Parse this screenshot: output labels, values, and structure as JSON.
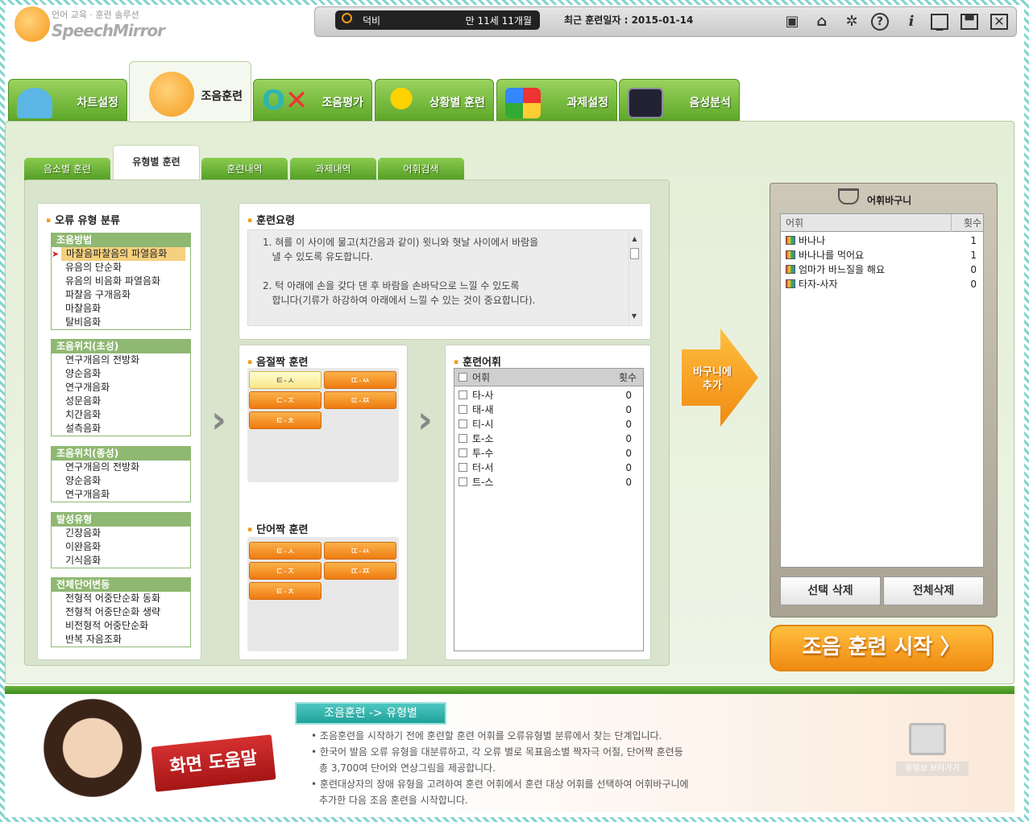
{
  "app": {
    "logo_sub": "언어 교육 · 훈련 솔루션",
    "logo_main": "SpeechMirror"
  },
  "user": {
    "name": "덕비",
    "age": "만 11세 11개월",
    "last_training": "최근 훈련일자 : 2015-01-14"
  },
  "toolbar_icons": [
    "person-desk-icon",
    "home-icon",
    "gear-icon",
    "help-icon",
    "info-icon",
    "minimize-icon",
    "restore-icon",
    "close-icon"
  ],
  "main_tabs": [
    "차트설정",
    "조음훈련",
    "조음평가",
    "상황별 훈련",
    "과제설정",
    "음성분석"
  ],
  "active_main_tab": "조음훈련",
  "sub_tabs": [
    "음소별 훈련",
    "유형별 훈련",
    "훈련내역",
    "과제내역",
    "어휘검색"
  ],
  "active_sub_tab": "유형별 훈련",
  "error_panel": {
    "title": "오류 유형 분류",
    "groups": [
      {
        "name": "조음방법",
        "items": [
          "마찰음파찰음의 파열음화",
          "유음의 단순화",
          "유음의 비음화 파열음화",
          "파찰음 구개음화",
          "마찰음화",
          "탈비음화"
        ],
        "selected": 0
      },
      {
        "name": "조음위치(초성)",
        "items": [
          "연구개음의 전방화",
          "양순음화",
          "연구개음화",
          "성문음화",
          "치간음화",
          "설측음화"
        ]
      },
      {
        "name": "조음위치(종성)",
        "items": [
          "연구개음의 전방화",
          "양순음화",
          "연구개음화"
        ]
      },
      {
        "name": "발성유형",
        "items": [
          "긴장음화",
          "이완음화",
          "기식음화"
        ]
      },
      {
        "name": "전체단어변동",
        "items": [
          "전형적 어중단순화 동화",
          "전형적 어중단순화 생략",
          "비전형적 어중단순화",
          "반복 자음조화"
        ]
      }
    ]
  },
  "training_guide": {
    "title": "훈련요령",
    "lines": [
      "1. 혀를 이 사이에 물고(치간음과 같이) 윗니와 혓날 사이에서 바람을",
      "   낼 수 있도록 유도합니다.",
      "",
      "2. 턱 아래에 손을 갖다 댄 후 바람을 손바닥으로 느낄 수 있도록",
      "   합니다(기류가 하강하여 아래에서 느낄 수 있는 것이 중요합니다)."
    ]
  },
  "syllable_pair": {
    "title": "음절짝 훈련",
    "buttons": [
      "ㅌ-ㅅ",
      "ㄸ-ㅆ",
      "ㄷ-ㅈ",
      "ㄸ-ㅉ",
      "ㅌ-ㅊ"
    ],
    "selected": 0
  },
  "word_pair": {
    "title": "단어짝 훈련",
    "buttons": [
      "ㅌ-ㅅ",
      "ㄸ-ㅆ",
      "ㄷ-ㅈ",
      "ㄸ-ㅉ",
      "ㅌ-ㅊ"
    ]
  },
  "training_words": {
    "title": "훈련어휘",
    "col_word": "어휘",
    "col_count": "횟수",
    "rows": [
      {
        "word": "타-사",
        "count": "0"
      },
      {
        "word": "태-새",
        "count": "0"
      },
      {
        "word": "티-시",
        "count": "0"
      },
      {
        "word": "토-소",
        "count": "0"
      },
      {
        "word": "투-수",
        "count": "0"
      },
      {
        "word": "터-서",
        "count": "0"
      },
      {
        "word": "트-스",
        "count": "0"
      }
    ]
  },
  "add_button": {
    "line1": "바구니에",
    "line2": "추가"
  },
  "basket": {
    "title": "어휘바구니",
    "col_word": "어휘",
    "col_count": "횟수",
    "rows": [
      {
        "word": "바나나",
        "count": "1"
      },
      {
        "word": "바나나를 먹어요",
        "count": "1"
      },
      {
        "word": "엄마가 바느질을 해요",
        "count": "0"
      },
      {
        "word": "타자-사자",
        "count": "0"
      }
    ],
    "delete_selected": "선택 삭제",
    "delete_all": "전체삭제"
  },
  "start_button": "조음 훈련 시작 〉",
  "help": {
    "sign": "화면 도움말",
    "title": "조음훈련 -> 유형별",
    "lines": [
      "조음훈련을 시작하기 전에 훈련할 훈련 어휘를 오류유형별 분류에서 찾는 단계입니다.",
      "한국어 발음 오류 유형을 대분류하고, 각 오류 별로 목표음소별 짝자극 어절, 단어짝 훈련등",
      "총 3,700여 단어와 연상그림을 제공합니다.",
      "훈련대상자의 장애 유형을 고려하여 훈련 어휘에서 훈련 대상 어휘를 선택하여 어휘바구니에",
      "추가한 다음 조음 훈련을 시작합니다."
    ],
    "video": "동영상 보러가기"
  }
}
